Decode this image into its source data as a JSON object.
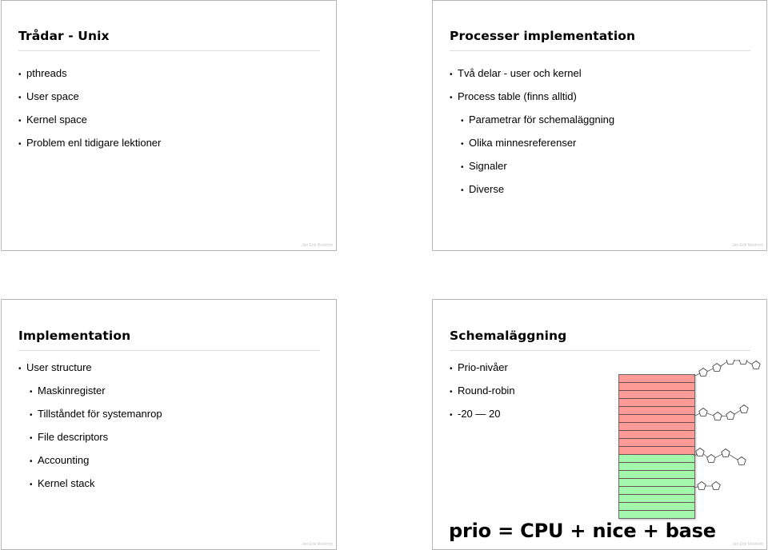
{
  "footer_author": "Jan Erik Moström",
  "slides": [
    {
      "title": "Trådar - Unix",
      "bullets": [
        {
          "text": "pthreads",
          "level": 1
        },
        {
          "text": "User space",
          "level": 1
        },
        {
          "text": "Kernel space",
          "level": 1
        },
        {
          "text": "Problem enl tidigare lektioner",
          "level": 1
        }
      ]
    },
    {
      "title": "Processer implementation",
      "bullets": [
        {
          "text": "Två delar - user och kernel",
          "level": 1
        },
        {
          "text": "Process table (finns alltid)",
          "level": 1
        },
        {
          "text": "Parametrar för schemaläggning",
          "level": 2
        },
        {
          "text": "Olika minnesreferenser",
          "level": 2
        },
        {
          "text": "Signaler",
          "level": 2
        },
        {
          "text": "Diverse",
          "level": 2
        }
      ]
    },
    {
      "title": "Implementation",
      "bullets": [
        {
          "text": "User structure",
          "level": 1
        },
        {
          "text": "Maskinregister",
          "level": 2
        },
        {
          "text": "Tillståndet för systemanrop",
          "level": 2
        },
        {
          "text": "File descriptors",
          "level": 2
        },
        {
          "text": "Accounting",
          "level": 2
        },
        {
          "text": "Kernel stack",
          "level": 2
        }
      ]
    },
    {
      "title": "Schemaläggning",
      "bullets": [
        {
          "text": "Prio-nivåer",
          "level": 1
        },
        {
          "text": "Round-robin",
          "level": 1
        },
        {
          "text": "-20 — 20",
          "level": 1
        }
      ],
      "formula": "prio = CPU + nice + base",
      "diagram": {
        "high_priority_rows": 10,
        "low_priority_rows": 8,
        "colors": {
          "high": "#ff9b96",
          "low": "#a3f7ad",
          "node": "#ffffff"
        },
        "queues": [
          {
            "attached_row": 0,
            "process_count": 5
          },
          {
            "attached_row": 5,
            "process_count": 4
          },
          {
            "attached_row": 10,
            "process_count": 4
          },
          {
            "attached_row": 14,
            "process_count": 2
          }
        ]
      }
    }
  ]
}
